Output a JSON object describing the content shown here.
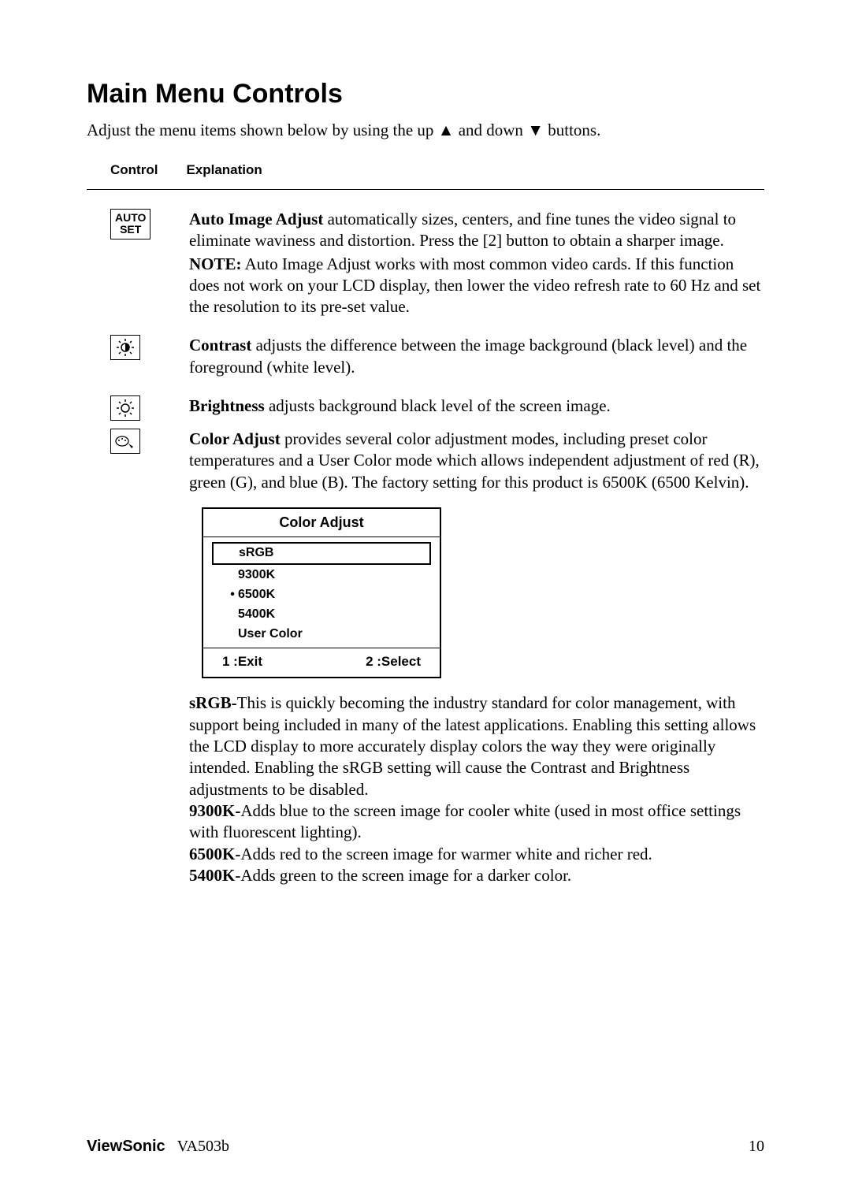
{
  "title": "Main Menu Controls",
  "intro_pre": "Adjust the menu items shown below by using the up ",
  "intro_mid": " and down ",
  "intro_post": " buttons.",
  "headers": {
    "control": "Control",
    "explanation": "Explanation"
  },
  "auto": {
    "icon_line1": "AUTO",
    "icon_line2": "SET",
    "t1_bold": "Auto Image Adjust",
    "t1_rest": " automatically sizes, centers, and fine tunes the video signal to eliminate waviness and distortion. Press the [2] button to obtain a sharper image.",
    "note_bold": "NOTE:",
    "note_rest": " Auto Image Adjust works with most common video cards. If this function does not work on your LCD display, then lower the video refresh rate to 60 Hz and set the resolution to its pre-set value."
  },
  "contrast": {
    "bold": "Contrast",
    "rest": " adjusts the difference between the image background  (black level) and the foreground (white level)."
  },
  "brightness": {
    "bold": "Brightness",
    "rest": " adjusts background black level of the screen image."
  },
  "coloradjust": {
    "bold": "Color Adjust",
    "rest": " provides several color adjustment modes, including preset color temperatures and a User Color mode which allows independent adjustment of red (R), green (G), and blue (B). The factory setting for this product is 6500K (6500 Kelvin)."
  },
  "menu": {
    "title": "Color Adjust",
    "items": {
      "srgb": "sRGB",
      "k9300": "9300K",
      "k6500": "6500K",
      "k5400": "5400K",
      "user": "User Color"
    },
    "exit": "1 :Exit",
    "select": "2 :Select"
  },
  "srgb": {
    "bold": "sRGB-",
    "rest": "This is quickly becoming the industry standard for color management, with support being included in many of the latest applications. Enabling this setting allows the LCD display to more accurately display colors the way they were originally intended. Enabling the sRGB setting will cause the Contrast and Brightness adjustments to be disabled."
  },
  "k9300": {
    "bold": "9300K-",
    "rest": "Adds blue to the screen image for cooler white (used in most office settings with fluorescent lighting)."
  },
  "k6500": {
    "bold": "6500K-",
    "rest": "Adds red to the screen image for warmer white and richer red."
  },
  "k5400": {
    "bold": "5400K-",
    "rest": "Adds green to the screen image for a darker color."
  },
  "footer": {
    "brand": "ViewSonic",
    "model": "VA503b",
    "page": "10"
  }
}
